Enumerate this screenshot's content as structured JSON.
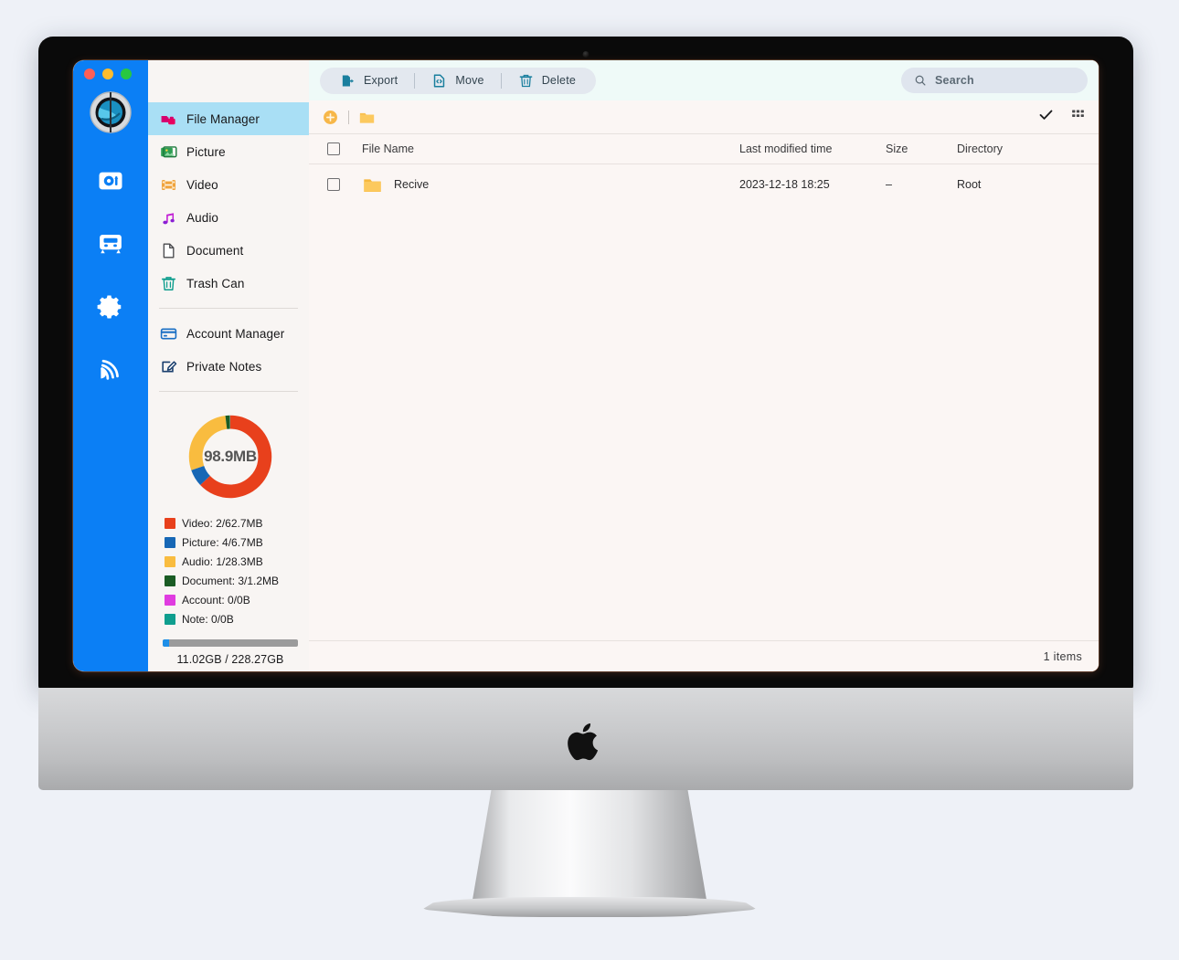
{
  "window": {
    "traffic_lights": [
      "close",
      "minimize",
      "zoom"
    ]
  },
  "rail": {
    "items": [
      {
        "name": "app-logo",
        "label": "App Logo"
      },
      {
        "name": "safe",
        "label": "Safe"
      },
      {
        "name": "transfer",
        "label": "Transfer"
      },
      {
        "name": "settings",
        "label": "Settings"
      },
      {
        "name": "cast",
        "label": "Cast"
      }
    ]
  },
  "sidebar": {
    "items": [
      {
        "label": "File Manager",
        "icon": "file-manager-icon",
        "active": true
      },
      {
        "label": "Picture",
        "icon": "picture-icon",
        "active": false
      },
      {
        "label": "Video",
        "icon": "video-icon",
        "active": false
      },
      {
        "label": "Audio",
        "icon": "audio-icon",
        "active": false
      },
      {
        "label": "Document",
        "icon": "document-icon",
        "active": false
      },
      {
        "label": "Trash Can",
        "icon": "trash-icon",
        "active": false
      }
    ],
    "items2": [
      {
        "label": "Account Manager",
        "icon": "card-icon",
        "active": false
      },
      {
        "label": "Private Notes",
        "icon": "note-edit-icon",
        "active": false
      }
    ]
  },
  "storage": {
    "total_label": "98.9MB",
    "legend": [
      {
        "label": "Video: 2/62.7MB",
        "color": "#e8401c"
      },
      {
        "label": "Picture: 4/6.7MB",
        "color": "#1767b5"
      },
      {
        "label": "Audio: 1/28.3MB",
        "color": "#f9bc3f"
      },
      {
        "label": "Document: 3/1.2MB",
        "color": "#1a5c24"
      },
      {
        "label": "Account: 0/0B",
        "color": "#e03ce0"
      },
      {
        "label": "Note: 0/0B",
        "color": "#0f9e8e"
      }
    ],
    "bar_percent": 4.8,
    "bar_text": "11.02GB / 228.27GB"
  },
  "chart_data": {
    "type": "pie",
    "title": "98.9MB",
    "categories": [
      "Video",
      "Picture",
      "Audio",
      "Document",
      "Account",
      "Note"
    ],
    "values": [
      62.7,
      6.7,
      28.3,
      1.2,
      0,
      0
    ],
    "counts": [
      2,
      4,
      1,
      3,
      0,
      0
    ],
    "unit": "MB",
    "colors": [
      "#e8401c",
      "#1767b5",
      "#f9bc3f",
      "#1a5c24",
      "#e03ce0",
      "#0f9e8e"
    ],
    "legend_position": "bottom",
    "legend_labels": [
      "Video: 2/62.7MB",
      "Picture: 4/6.7MB",
      "Audio: 1/28.3MB",
      "Document: 3/1.2MB",
      "Account: 0/0B",
      "Note: 0/0B"
    ]
  },
  "toolbar": {
    "export_label": "Export",
    "move_label": "Move",
    "delete_label": "Delete"
  },
  "search": {
    "placeholder": "Search",
    "value": ""
  },
  "table": {
    "columns": {
      "name": "File Name",
      "time": "Last modified time",
      "size": "Size",
      "directory": "Directory"
    },
    "rows": [
      {
        "name": "Recive",
        "time": "2023-12-18 18:25",
        "size": "–",
        "directory": "Root",
        "checked": false
      }
    ]
  },
  "status": {
    "item_count": "1 items"
  }
}
